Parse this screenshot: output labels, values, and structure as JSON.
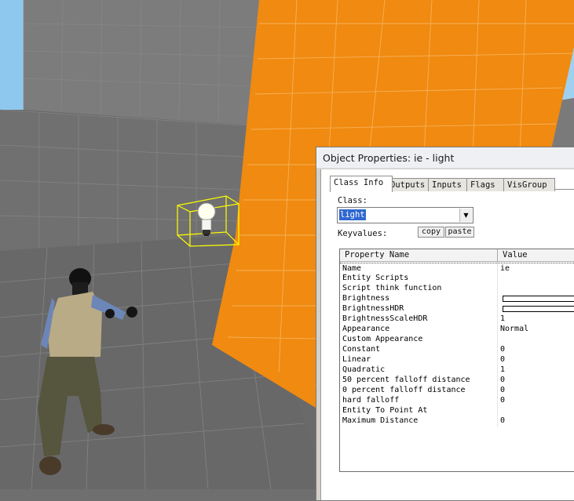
{
  "window": {
    "title": "Object Properties: ie - light"
  },
  "tabs": [
    {
      "label": "Class Info",
      "active": true
    },
    {
      "label": "Outputs",
      "active": false
    },
    {
      "label": "Inputs",
      "active": false
    },
    {
      "label": "Flags",
      "active": false
    },
    {
      "label": "VisGroup",
      "active": false
    }
  ],
  "class_label": "Class:",
  "class_value": "light",
  "keyvalues_label": "Keyvalues:",
  "buttons": {
    "copy": "copy",
    "paste": "paste"
  },
  "table": {
    "headers": {
      "property": "Property Name",
      "value": "Value"
    },
    "rows": [
      {
        "name": "Name",
        "value": "ie"
      },
      {
        "name": "Entity Scripts",
        "value": ""
      },
      {
        "name": "Script think function",
        "value": ""
      },
      {
        "name": "Brightness",
        "value": "",
        "bar": true
      },
      {
        "name": "BrightnessHDR",
        "value": "",
        "bar": true
      },
      {
        "name": "BrightnessScaleHDR",
        "value": "1"
      },
      {
        "name": "Appearance",
        "value": "Normal"
      },
      {
        "name": "Custom Appearance",
        "value": ""
      },
      {
        "name": "Constant",
        "value": "0"
      },
      {
        "name": "Linear",
        "value": "0"
      },
      {
        "name": "Quadratic",
        "value": "1"
      },
      {
        "name": "50 percent falloff distance",
        "value": "0"
      },
      {
        "name": "0 percent falloff distance",
        "value": "0"
      },
      {
        "name": "hard falloff",
        "value": "0"
      },
      {
        "name": "Entity To Point At",
        "value": ""
      },
      {
        "name": "Maximum Distance",
        "value": "0"
      }
    ]
  },
  "viewport": {
    "icons": [
      "light-bulb-icon",
      "player-model"
    ],
    "colors": {
      "wall_orange": "#f08a10",
      "wall_gray": "#7b7b7b",
      "floor_gray": "#696969",
      "sky": "#8fc8ee",
      "selection": "#ffff00"
    }
  }
}
